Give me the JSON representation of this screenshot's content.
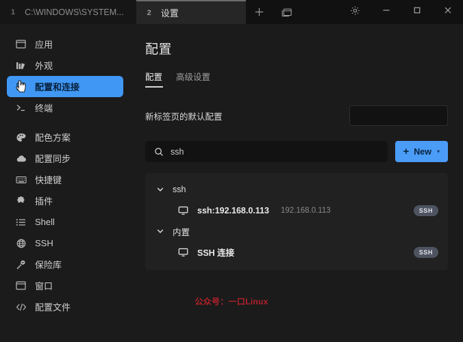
{
  "window": {
    "tabs": [
      {
        "number": "1",
        "label": "C:\\WINDOWS\\SYSTEM...",
        "active": false
      },
      {
        "number": "2",
        "label": "设置",
        "active": true
      }
    ],
    "new_tab_icon": "plus-icon",
    "split_pane_icon": "split-pane-icon",
    "settings_icon": "gear-icon",
    "minimize_icon": "minimize-icon",
    "maximize_icon": "maximize-icon",
    "close_icon": "close-icon"
  },
  "sidebar": {
    "items": [
      {
        "label": "应用",
        "icon": "app-window-icon",
        "selected": false
      },
      {
        "label": "外观",
        "icon": "appearance-icon",
        "selected": false
      },
      {
        "label": "配置和连接",
        "icon": "profiles-icon",
        "selected": true
      },
      {
        "label": "终端",
        "icon": "terminal-icon",
        "selected": false
      },
      {
        "label": "配色方案",
        "icon": "palette-icon",
        "selected": false
      },
      {
        "label": "配置同步",
        "icon": "cloud-sync-icon",
        "selected": false
      },
      {
        "label": "快捷键",
        "icon": "keyboard-icon",
        "selected": false
      },
      {
        "label": "插件",
        "icon": "puzzle-plugin-icon",
        "selected": false
      },
      {
        "label": "Shell",
        "icon": "list-shell-icon",
        "selected": false
      },
      {
        "label": "SSH",
        "icon": "globe-icon",
        "selected": false
      },
      {
        "label": "保险库",
        "icon": "key-vault-icon",
        "selected": false
      },
      {
        "label": "窗口",
        "icon": "window-icon",
        "selected": false
      },
      {
        "label": "配置文件",
        "icon": "code-file-icon",
        "selected": false
      }
    ]
  },
  "main": {
    "title": "配置",
    "tabs": [
      {
        "label": "配置",
        "active": true
      },
      {
        "label": "高级设置",
        "active": false
      }
    ],
    "default_profile": {
      "label": "新标签页的默认配置",
      "value": ""
    },
    "search": {
      "value": "ssh",
      "placeholder": "",
      "icon": "search-icon"
    },
    "new_button": {
      "label": "New",
      "plus": "+",
      "caret": "▾"
    },
    "groups": [
      {
        "name": "ssh",
        "chevron": "chevron-down-icon",
        "entries": [
          {
            "icon": "monitor-icon",
            "name": "ssh:192.168.0.113",
            "subtitle": "192.168.0.113",
            "badge": "SSH"
          }
        ]
      },
      {
        "name": "内置",
        "chevron": "chevron-down-icon",
        "entries": [
          {
            "icon": "monitor-icon",
            "name": "SSH 连接",
            "subtitle": "",
            "badge": "SSH"
          }
        ]
      }
    ]
  },
  "watermark": {
    "text": "公众号：一口Linux",
    "color": "#b3212b"
  },
  "colors": {
    "accent": "#4a9cf6",
    "sidebar_selected": "#4098f4",
    "window_bg": "#1b1b1b",
    "titlebar_bg": "#111111",
    "list_bg": "#212121",
    "badge_bg": "#4d5360"
  }
}
